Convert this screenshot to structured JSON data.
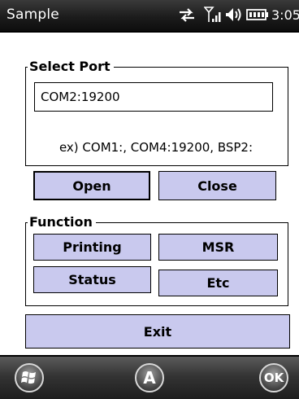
{
  "statusbar": {
    "app_title": "Sample",
    "time": "3:05",
    "icons": [
      "sync-arrows-icon",
      "signal-strength-icon",
      "speaker-icon",
      "battery-icon"
    ]
  },
  "port_group": {
    "legend": "Select Port",
    "input_value": "COM2:19200",
    "hint": "ex) COM1:, COM4:19200, BSP2:"
  },
  "buttons": {
    "open": "Open",
    "close": "Close",
    "exit": "Exit"
  },
  "function_group": {
    "legend": "Function",
    "printing": "Printing",
    "msr": "MSR",
    "status": "Status",
    "etc": "Etc"
  },
  "bottombar": {
    "start_icon": "windows-start-icon",
    "center_label": "A",
    "ok_label": "OK"
  },
  "colors": {
    "button_fill": "#c9c9ee",
    "titlebar": "#1c1c1c"
  }
}
